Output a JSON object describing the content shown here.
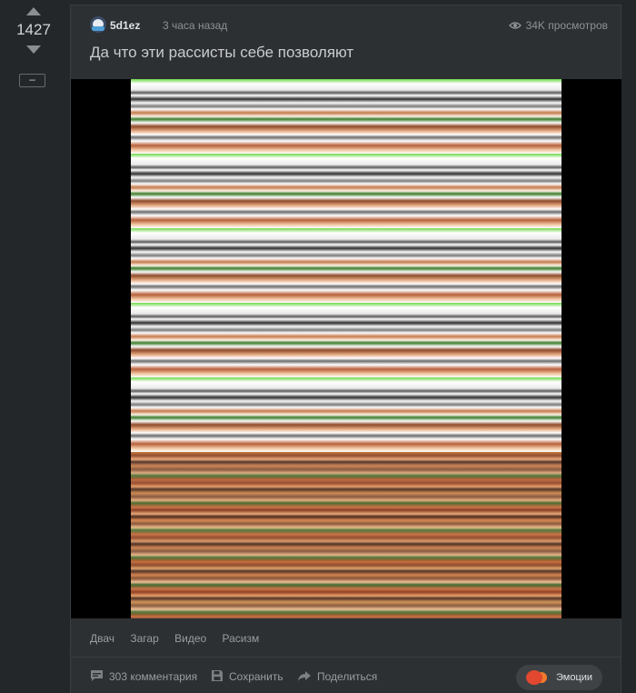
{
  "vote": {
    "count": "1427"
  },
  "collapse": {
    "label": "–"
  },
  "post": {
    "author": "5d1ez",
    "time": "3 часа назад",
    "views": "34K просмотров",
    "title": "Да что эти рассисты себе позволяют"
  },
  "tags": [
    "Двач",
    "Загар",
    "Видео",
    "Расизм"
  ],
  "actions": {
    "comments": "303 комментария",
    "save": "Сохранить",
    "share": "Поделиться",
    "emotions": "Эмоции"
  },
  "icons": {
    "upvote": "triangle-up-icon",
    "downvote": "triangle-down-icon",
    "views": "eye-icon",
    "comments": "comment-icon",
    "save": "floppy-icon",
    "share": "share-arrow-icon",
    "emotions": "emoji-icon"
  },
  "colors": {
    "background": "#242729",
    "card": "#2d3033",
    "text": "#c8cbcd",
    "muted": "#8e9194"
  }
}
